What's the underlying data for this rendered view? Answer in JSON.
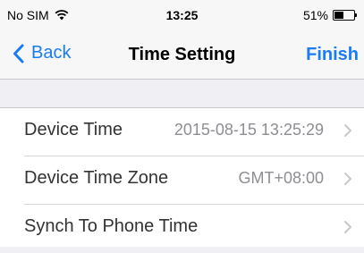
{
  "status_bar": {
    "carrier": "No SIM",
    "time": "13:25",
    "battery_percent": "51%",
    "battery_level": 0.51,
    "wifi_icon": "wifi-icon",
    "battery_icon": "battery-icon"
  },
  "nav": {
    "back_label": "Back",
    "title": "Time Setting",
    "finish_label": "Finish",
    "accent_color": "#1a7cf4"
  },
  "rows": [
    {
      "label": "Device Time",
      "value": "2015-08-15 13:25:29"
    },
    {
      "label": "Device Time Zone",
      "value": "GMT+08:00"
    },
    {
      "label": "Synch To Phone Time",
      "value": ""
    }
  ]
}
